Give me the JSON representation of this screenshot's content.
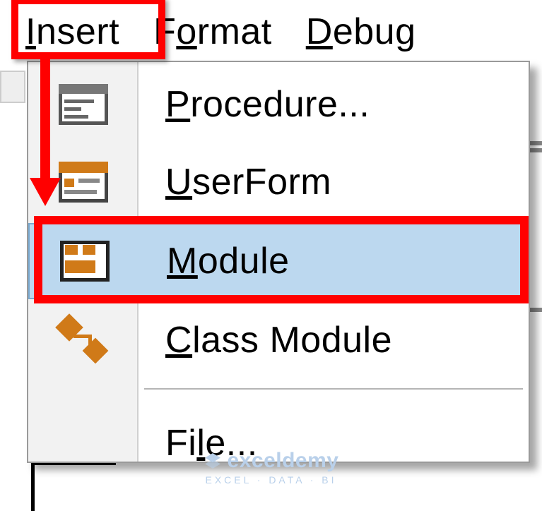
{
  "menubar": {
    "insert": {
      "accel": "I",
      "rest": "nsert"
    },
    "format": {
      "accel": "o",
      "pre": "F",
      "rest": "rmat"
    },
    "debug": {
      "accel": "D",
      "rest": "ebug"
    }
  },
  "dropdown": {
    "procedure": {
      "accel": "P",
      "rest": "rocedure..."
    },
    "userform": {
      "accel": "U",
      "rest": "serForm"
    },
    "module": {
      "accel": "M",
      "rest": "odule"
    },
    "classmod": {
      "accel": "C",
      "rest": "lass Module"
    },
    "file": {
      "accel": "l",
      "pre": "Fi",
      "rest": "e..."
    }
  },
  "watermark": {
    "brand": "exceldemy",
    "tagline": "EXCEL · DATA · BI"
  }
}
